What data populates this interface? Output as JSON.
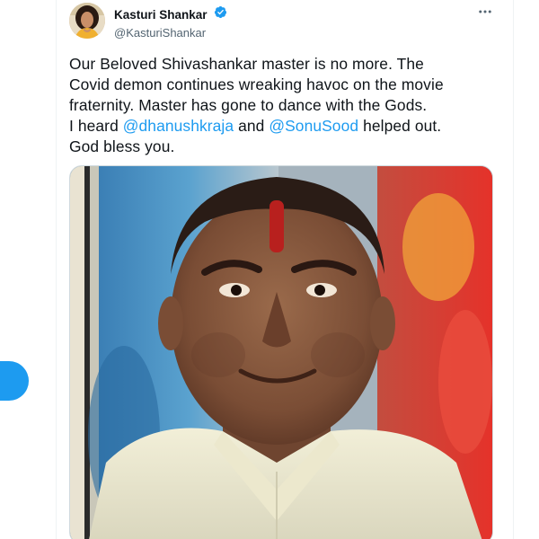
{
  "tweet": {
    "author": {
      "display_name": "Kasturi Shankar",
      "handle": "@KasturiShankar",
      "verified": true
    },
    "more_icon": "ellipsis-icon",
    "text": {
      "line1": "Our Beloved Shivashankar master is no more. The",
      "line2": "Covid demon continues wreaking havoc on the movie",
      "line3": "fraternity. Master has gone to dance with the Gods.",
      "line4_prefix": "I heard ",
      "mention1": "@dhanushkraja",
      "line4_mid": " and ",
      "mention2": "@SonuSood",
      "line4_suffix": " helped out.",
      "line5": "God bless you."
    },
    "media": {
      "kind": "photo"
    }
  },
  "colors": {
    "accent": "#1d9bf0",
    "text": "#0f1419",
    "secondary": "#536471",
    "border": "#cfd9de"
  }
}
